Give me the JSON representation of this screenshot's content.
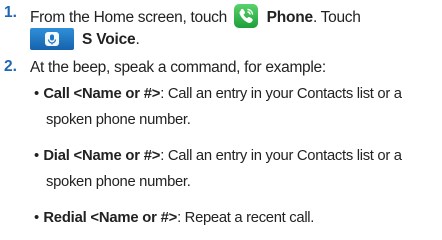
{
  "steps": [
    {
      "number": "1.",
      "line1_pre": "From the Home screen, touch",
      "line1_icon": "phone-app-icon",
      "line1_bold": "Phone",
      "line1_post": ". Touch",
      "line2_icon": "s-voice-icon",
      "line2_bold": "S Voice",
      "line2_post": "."
    },
    {
      "number": "2.",
      "text": "At the beep, speak a command, for example:"
    }
  ],
  "bullets": [
    {
      "bullet": "•",
      "label": "Call <Name or #>",
      "desc_line1": ": Call an entry in your Contacts list or a",
      "desc_line2": "spoken phone number."
    },
    {
      "bullet": "•",
      "label": "Dial <Name or #>",
      "desc_line1": ": Call an entry in your Contacts list or a",
      "desc_line2": "spoken phone number."
    },
    {
      "bullet": "•",
      "label": "Redial <Name or #>",
      "desc_line1": ": Repeat a recent call.",
      "desc_line2": ""
    }
  ],
  "colors": {
    "step_number": "#1f66b3",
    "phone_icon": "#2fb24a",
    "s_voice_icon": "#1f75c4"
  }
}
